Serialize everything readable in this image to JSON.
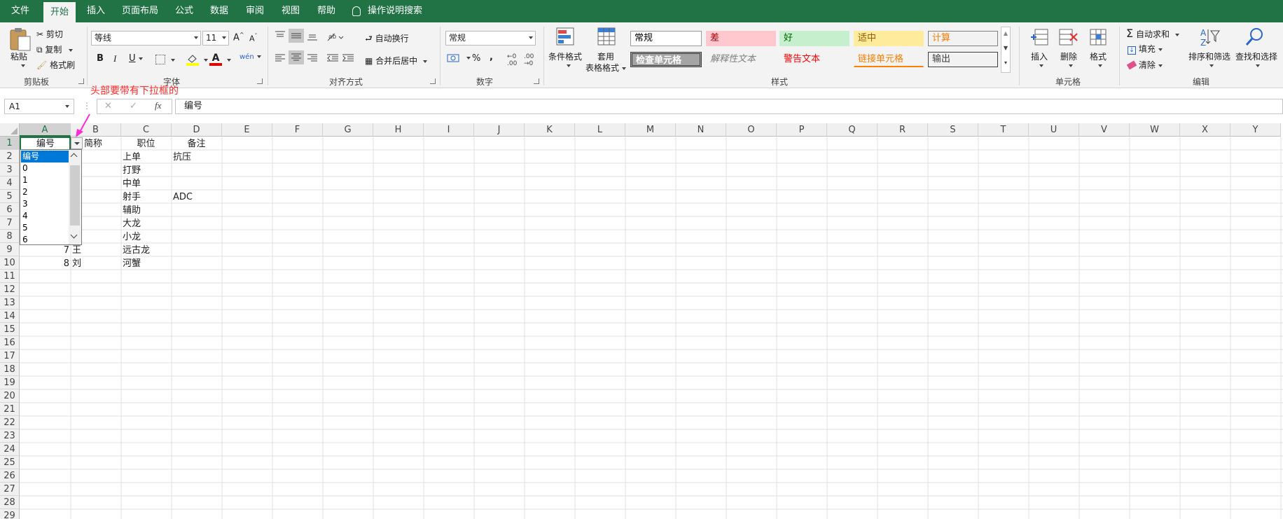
{
  "tabs": [
    "文件",
    "开始",
    "插入",
    "页面布局",
    "公式",
    "数据",
    "审阅",
    "视图",
    "帮助"
  ],
  "active_tab": "开始",
  "tell_me": "操作说明搜索",
  "clipboard": {
    "paste": "粘贴",
    "cut": "剪切",
    "copy": "复制",
    "format_painter": "格式刷",
    "title": "剪贴板"
  },
  "font": {
    "name": "等线",
    "size": "11",
    "bold": "B",
    "italic": "I",
    "underline": "U",
    "grow": "A",
    "shrink": "A",
    "phonetic": "wén",
    "title": "字体"
  },
  "alignment": {
    "wrap": "自动换行",
    "merge": "合并后居中",
    "title": "对齐方式"
  },
  "number": {
    "format": "常规",
    "percent": "%",
    "comma": ",",
    "title": "数字"
  },
  "styles": {
    "conditional": "条件格式",
    "table_line1": "套用",
    "table_line2": "表格格式",
    "cells": [
      "常规",
      "差",
      "好",
      "适中",
      "计算",
      "检查单元格",
      "解释性文本",
      "警告文本",
      "链接单元格",
      "输出"
    ],
    "title": "样式"
  },
  "cells_group": {
    "insert": "插入",
    "delete": "删除",
    "format": "格式",
    "title": "单元格"
  },
  "editing": {
    "autosum": "自动求和",
    "fill": "填充",
    "clear": "清除",
    "sort": "排序和筛选",
    "find": "查找和选择",
    "title": "编辑"
  },
  "formula_bar": {
    "name_box": "A1",
    "cancel": "✕",
    "enter": "✓",
    "fx": "fx",
    "content": "编号"
  },
  "annotation": "头部要带有下拉框的",
  "columns": [
    "A",
    "B",
    "C",
    "D",
    "E",
    "F",
    "G",
    "H",
    "I",
    "J",
    "K",
    "L",
    "M",
    "N",
    "O",
    "P",
    "Q",
    "R",
    "S",
    "T",
    "U",
    "V",
    "W",
    "X",
    "Y"
  ],
  "row_numbers": [
    "1",
    "2",
    "3",
    "4",
    "5",
    "6",
    "7",
    "8",
    "9",
    "10",
    "11",
    "12",
    "13",
    "14",
    "15",
    "16",
    "17",
    "18",
    "19",
    "20",
    "21",
    "22",
    "23",
    "24",
    "25",
    "26",
    "27",
    "28",
    "29"
  ],
  "headers": {
    "a1": "编号",
    "b1": "简称",
    "c1": "职位",
    "d1": "备注"
  },
  "cells": {
    "c2": "上单",
    "d2": "抗压",
    "c3": "打野",
    "c4": "中单",
    "c5": "射手",
    "d5": "ADC",
    "c6": "辅助",
    "c7": "大龙",
    "c8": "小龙",
    "a9": "7",
    "b9": "王",
    "c9": "远古龙",
    "a10": "8",
    "b10": "刘",
    "c10": "河蟹"
  },
  "dropdown": {
    "items": [
      "编号",
      "0",
      "1",
      "2",
      "3",
      "4",
      "5",
      "6"
    ],
    "selected": "编号"
  }
}
